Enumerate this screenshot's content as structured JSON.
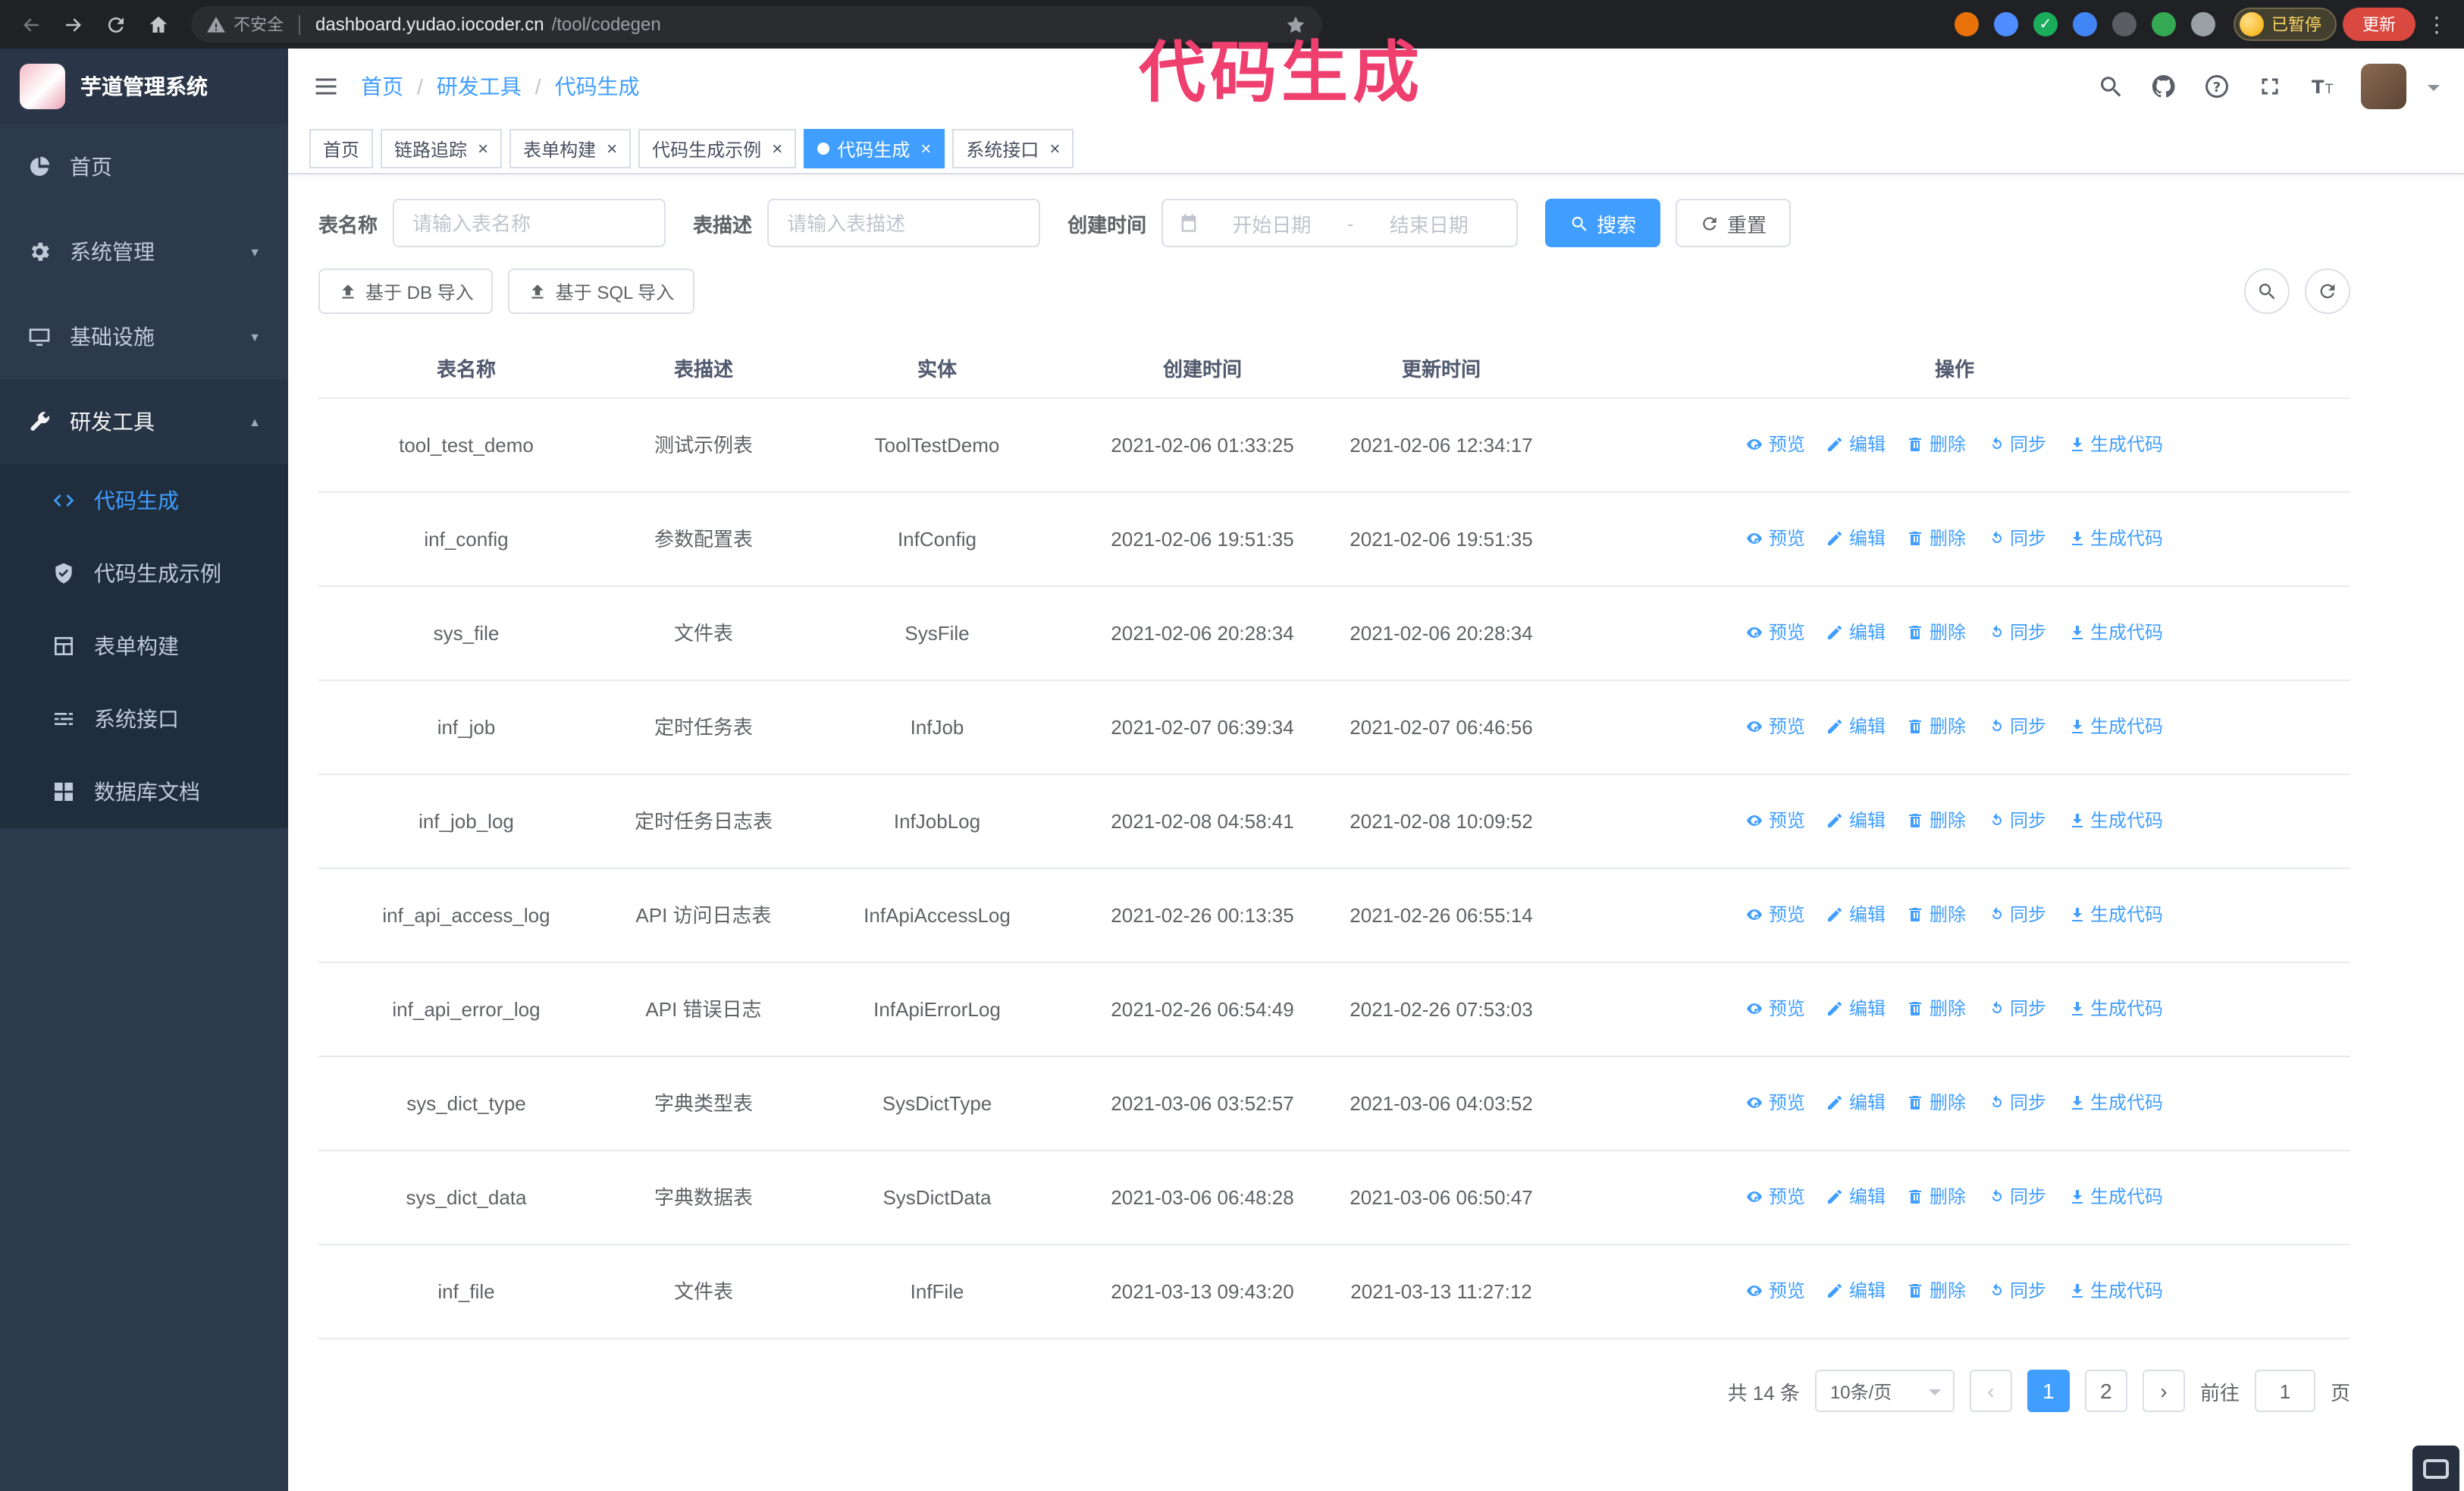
{
  "colors": {
    "primary": "#409eff",
    "sidebar_bg": "#2d3a4b",
    "submenu_bg": "#1f2d3d",
    "annotation": "#ee3f6f"
  },
  "annotation": {
    "text": "代码生成",
    "color": "#ee3f6f"
  },
  "browser": {
    "security_text": "不安全",
    "url_host": "dashboard.yudao.iocoder.cn",
    "url_path": "/tool/codegen",
    "paused_badge": "已暂停",
    "update_button": "更新",
    "extensions": [
      {
        "name": "extension-orange",
        "color": "#e8710a",
        "glyph": ""
      },
      {
        "name": "extension-blue-drop",
        "color": "#4e8cff",
        "glyph": ""
      },
      {
        "name": "extension-green-check",
        "color": "#1aae5c",
        "glyph": "✓"
      },
      {
        "name": "extension-people",
        "color": "#4285f4",
        "glyph": ""
      },
      {
        "name": "extension-card",
        "color": "#5a5d62",
        "glyph": ""
      },
      {
        "name": "extension-leaf",
        "color": "#34a853",
        "glyph": ""
      },
      {
        "name": "extension-puzzle",
        "color": "#9aa0a6",
        "glyph": ""
      }
    ]
  },
  "sidebar": {
    "logo_title": "芋道管理系统",
    "menu": [
      {
        "key": "home",
        "label": "首页",
        "icon": "dashboard",
        "arrow": null,
        "expanded": false
      },
      {
        "key": "system",
        "label": "系统管理",
        "icon": "gear",
        "arrow": "down",
        "expanded": false
      },
      {
        "key": "infrastructure",
        "label": "基础设施",
        "icon": "monitor",
        "arrow": "down",
        "expanded": false
      },
      {
        "key": "dev-tools",
        "label": "研发工具",
        "icon": "wrench",
        "arrow": "up",
        "expanded": true
      }
    ],
    "submenu": [
      {
        "key": "codegen",
        "label": "代码生成",
        "icon": "code",
        "active": true
      },
      {
        "key": "codegen-example",
        "label": "代码生成示例",
        "icon": "shield",
        "active": false
      },
      {
        "key": "form-builder",
        "label": "表单构建",
        "icon": "form",
        "active": false
      },
      {
        "key": "api",
        "label": "系统接口",
        "icon": "sliders",
        "active": false
      },
      {
        "key": "db-doc",
        "label": "数据库文档",
        "icon": "grid",
        "active": false
      }
    ]
  },
  "navbar": {
    "breadcrumb": [
      "首页",
      "研发工具",
      "代码生成"
    ],
    "tools": [
      "search",
      "github",
      "help",
      "fullscreen",
      "font-size"
    ]
  },
  "tabs": [
    {
      "key": "home",
      "label": "首页",
      "closable": false,
      "active": false
    },
    {
      "key": "tracer",
      "label": "链路追踪",
      "closable": true,
      "active": false
    },
    {
      "key": "form-builder",
      "label": "表单构建",
      "closable": true,
      "active": false
    },
    {
      "key": "codegen-example",
      "label": "代码生成示例",
      "closable": true,
      "active": false
    },
    {
      "key": "codegen",
      "label": "代码生成",
      "closable": true,
      "active": true
    },
    {
      "key": "api",
      "label": "系统接口",
      "closable": true,
      "active": false
    }
  ],
  "filters": {
    "table_name_label": "表名称",
    "table_name_placeholder": "请输入表名称",
    "table_desc_label": "表描述",
    "table_desc_placeholder": "请输入表描述",
    "create_time_label": "创建时间",
    "date_start_placeholder": "开始日期",
    "date_separator": "-",
    "date_end_placeholder": "结束日期",
    "search_button": "搜索",
    "reset_button": "重置"
  },
  "toolbar": {
    "import_db": "基于 DB 导入",
    "import_sql": "基于 SQL 导入"
  },
  "table": {
    "columns": [
      "表名称",
      "表描述",
      "实体",
      "创建时间",
      "更新时间",
      "操作"
    ],
    "row_actions": [
      "预览",
      "编辑",
      "删除",
      "同步",
      "生成代码"
    ],
    "rows": [
      {
        "name": "tool_test_demo",
        "desc": "测试示例表",
        "entity": "ToolTestDemo",
        "created": "2021-02-06 01:33:25",
        "updated": "2021-02-06 12:34:17"
      },
      {
        "name": "inf_config",
        "desc": "参数配置表",
        "entity": "InfConfig",
        "created": "2021-02-06 19:51:35",
        "updated": "2021-02-06 19:51:35"
      },
      {
        "name": "sys_file",
        "desc": "文件表",
        "entity": "SysFile",
        "created": "2021-02-06 20:28:34",
        "updated": "2021-02-06 20:28:34"
      },
      {
        "name": "inf_job",
        "desc": "定时任务表",
        "entity": "InfJob",
        "created": "2021-02-07 06:39:34",
        "updated": "2021-02-07 06:46:56"
      },
      {
        "name": "inf_job_log",
        "desc": "定时任务日志表",
        "entity": "InfJobLog",
        "created": "2021-02-08 04:58:41",
        "updated": "2021-02-08 10:09:52"
      },
      {
        "name": "inf_api_access_log",
        "desc": "API 访问日志表",
        "entity": "InfApiAccessLog",
        "created": "2021-02-26 00:13:35",
        "updated": "2021-02-26 06:55:14"
      },
      {
        "name": "inf_api_error_log",
        "desc": "API 错误日志",
        "entity": "InfApiErrorLog",
        "created": "2021-02-26 06:54:49",
        "updated": "2021-02-26 07:53:03"
      },
      {
        "name": "sys_dict_type",
        "desc": "字典类型表",
        "entity": "SysDictType",
        "created": "2021-03-06 03:52:57",
        "updated": "2021-03-06 04:03:52"
      },
      {
        "name": "sys_dict_data",
        "desc": "字典数据表",
        "entity": "SysDictData",
        "created": "2021-03-06 06:48:28",
        "updated": "2021-03-06 06:50:47"
      },
      {
        "name": "inf_file",
        "desc": "文件表",
        "entity": "InfFile",
        "created": "2021-03-13 09:43:20",
        "updated": "2021-03-13 11:27:12"
      }
    ]
  },
  "pagination": {
    "total_text": "共 14 条",
    "page_size": "10条/页",
    "pages": [
      {
        "label": "1",
        "active": true
      },
      {
        "label": "2",
        "active": false
      }
    ],
    "prev_icon": "‹",
    "next_icon": "›",
    "goto_prefix": "前往",
    "goto_value": "1",
    "goto_suffix": "页"
  }
}
